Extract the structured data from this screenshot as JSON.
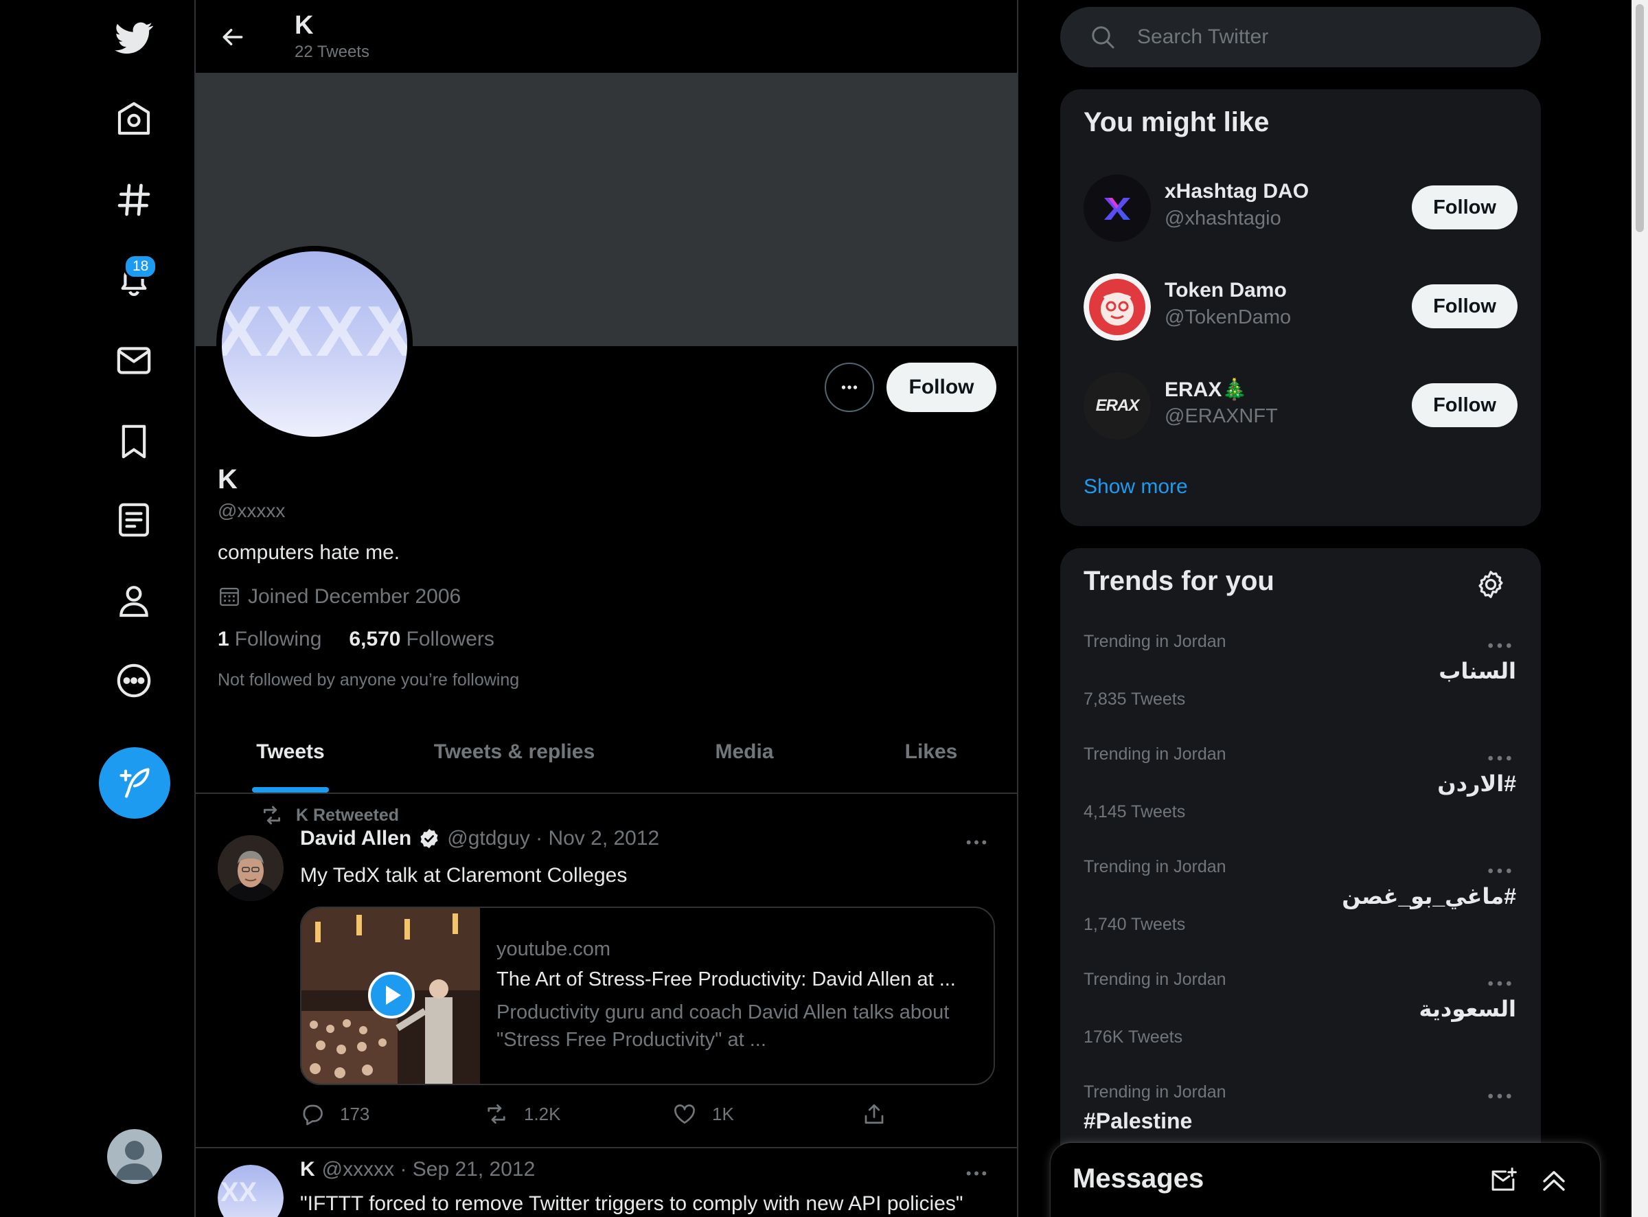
{
  "colors": {
    "accent": "#1d9bf0",
    "background": "#000000",
    "panel": "#16181c",
    "text": "#e7e9ea",
    "muted": "#71767b"
  },
  "nav": {
    "items": [
      {
        "icon": "twitter-logo-icon"
      },
      {
        "icon": "home-icon"
      },
      {
        "icon": "explore-hashtag-icon"
      },
      {
        "icon": "notifications-bell-icon",
        "badge": "18"
      },
      {
        "icon": "messages-envelope-icon"
      },
      {
        "icon": "bookmark-icon"
      },
      {
        "icon": "lists-icon"
      },
      {
        "icon": "profile-icon"
      },
      {
        "icon": "more-circle-icon"
      }
    ],
    "compose_icon": "compose-tweet-icon",
    "account_icon": "account-avatar"
  },
  "header": {
    "title": "K",
    "subtitle": "22 Tweets"
  },
  "profile": {
    "avatar_text": "XXXX",
    "name": "K",
    "handle": "@xxxxx",
    "bio": "computers hate me.",
    "joined": "Joined December 2006",
    "following_count": "1",
    "following_label": "Following",
    "followers_count": "6,570",
    "followers_label": "Followers",
    "not_followed": "Not followed by anyone you’re following",
    "follow_label": "Follow"
  },
  "tabs": [
    {
      "label": "Tweets",
      "active": true
    },
    {
      "label": "Tweets & replies",
      "active": false
    },
    {
      "label": "Media",
      "active": false
    },
    {
      "label": "Likes",
      "active": false
    }
  ],
  "tweets": [
    {
      "retweeted_by": "K Retweeted",
      "name": "David Allen",
      "verified": true,
      "meta": "@gtdguy · Nov 2, 2012",
      "text": "My TedX talk at Claremont Colleges",
      "card": {
        "domain": "youtube.com",
        "title": "The Art of Stress-Free Productivity: David Allen at ...",
        "description": "Productivity guru and coach David Allen talks about \"Stress Free Productivity\" at ..."
      },
      "replies": "173",
      "retweets": "1.2K",
      "likes": "1K"
    },
    {
      "avatar_text": "XX",
      "name": "K",
      "meta": "@xxxxx · Sep 21, 2012",
      "text": "\"IFTTT forced to remove Twitter triggers to comply with new API policies\""
    }
  ],
  "search": {
    "placeholder": "Search Twitter"
  },
  "who_to_follow": {
    "title": "You might like",
    "users": [
      {
        "name": "xHashtag DAO",
        "handle": "@xhashtagio",
        "follow_label": "Follow"
      },
      {
        "name": "Token Damo",
        "handle": "@TokenDamo",
        "follow_label": "Follow"
      },
      {
        "name": "ERAX🎄",
        "handle": "@ERAXNFT",
        "follow_label": "Follow",
        "logo_text": "ERAX"
      }
    ],
    "show_more": "Show more"
  },
  "trends": {
    "title": "Trends for you",
    "items": [
      {
        "context": "Trending in Jordan",
        "name": "السناب",
        "count": "7,835 Tweets"
      },
      {
        "context": "Trending in Jordan",
        "name": "#الاردن",
        "count": "4,145 Tweets"
      },
      {
        "context": "Trending in Jordan",
        "name": "#ماغي_بو_غصن",
        "count": "1,740 Tweets"
      },
      {
        "context": "Trending in Jordan",
        "name": "السعودية",
        "count": "176K Tweets"
      },
      {
        "context": "Trending in Jordan",
        "name": "#Palestine",
        "count": ""
      }
    ]
  },
  "messages": {
    "title": "Messages"
  }
}
